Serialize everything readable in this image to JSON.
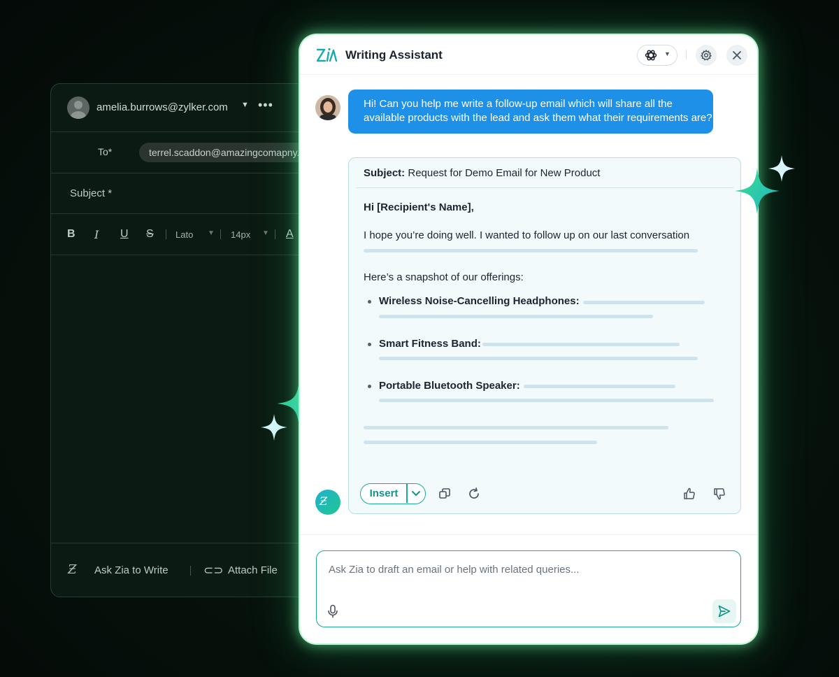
{
  "compose": {
    "from_email": "amelia.burrows@zylker.com",
    "to_label": "To*",
    "to_recipient": "terrel.scaddon@amazingcomapny.com",
    "subject_label": "Subject *",
    "toolbar": {
      "bold": "B",
      "italic": "I",
      "underline": "U",
      "strike": "S",
      "font": "Lato",
      "size": "14px",
      "text_color": "A"
    },
    "ask_zia_label": "Ask Zia to Write",
    "attach_label": "Attach File"
  },
  "assistant": {
    "title": "Writing Assistant",
    "user_message": "Hi! Can you help me write a follow-up email which will share all the available products with the lead and ask them what their requirements are?",
    "reply": {
      "subject_label": "Subject:",
      "subject_value": "Request for Demo Email for New Product",
      "greeting": "Hi [Recipient's Name],",
      "intro": "I hope you’re doing well. I wanted to follow up on our last conversation",
      "offerings_heading": "Here’s a snapshot of our offerings:",
      "products": [
        "Wireless Noise-Cancelling Headphones:",
        "Smart Fitness Band:",
        "Portable Bluetooth Speaker:"
      ]
    },
    "insert_label": "Insert",
    "prompt_placeholder": "Ask Zia to draft an email or help with related queries..."
  },
  "colors": {
    "accent_teal": "#1aa99b",
    "user_bubble": "#1e90e8",
    "glow_green": "#6ef0a0"
  },
  "icons": [
    "zia-logo-icon",
    "openai-icon",
    "gear-icon",
    "close-icon",
    "copy-icon",
    "refresh-icon",
    "thumbs-up-icon",
    "thumbs-down-icon",
    "mic-icon",
    "send-icon",
    "attach-icon",
    "sparkle-icon"
  ]
}
